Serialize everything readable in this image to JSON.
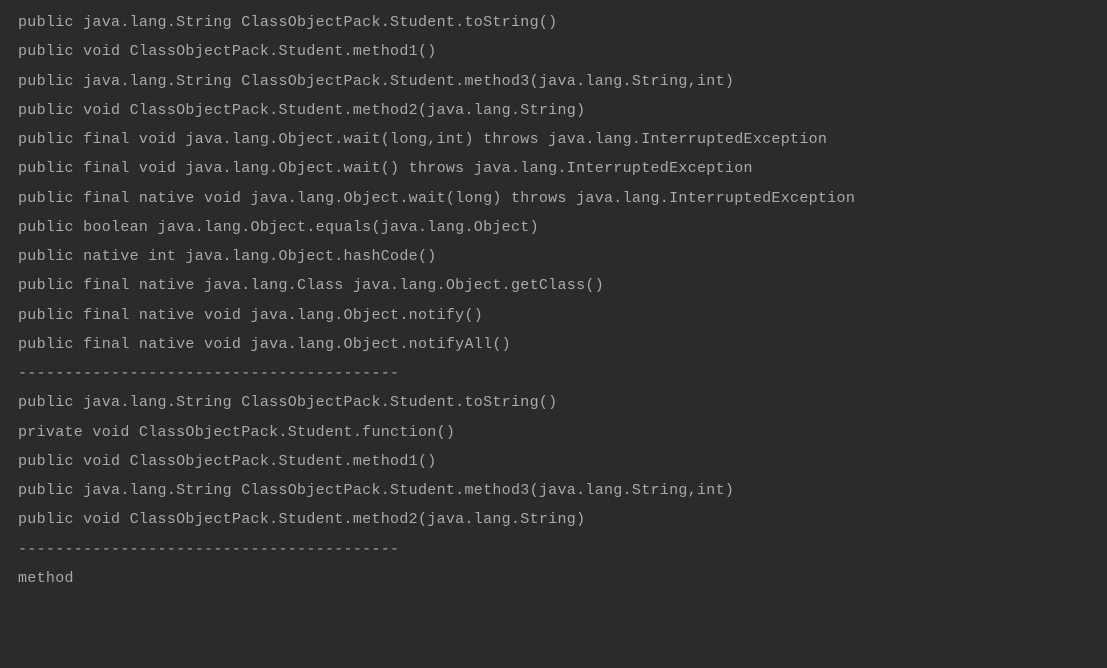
{
  "lines": [
    "public java.lang.String ClassObjectPack.Student.toString()",
    "public void ClassObjectPack.Student.method1()",
    "public java.lang.String ClassObjectPack.Student.method3(java.lang.String,int)",
    "public void ClassObjectPack.Student.method2(java.lang.String)",
    "public final void java.lang.Object.wait(long,int) throws java.lang.InterruptedException",
    "public final void java.lang.Object.wait() throws java.lang.InterruptedException",
    "public final native void java.lang.Object.wait(long) throws java.lang.InterruptedException",
    "public boolean java.lang.Object.equals(java.lang.Object)",
    "public native int java.lang.Object.hashCode()",
    "public final native java.lang.Class java.lang.Object.getClass()",
    "public final native void java.lang.Object.notify()",
    "public final native void java.lang.Object.notifyAll()",
    "-----------------------------------------",
    "public java.lang.String ClassObjectPack.Student.toString()",
    "private void ClassObjectPack.Student.function()",
    "public void ClassObjectPack.Student.method1()",
    "public java.lang.String ClassObjectPack.Student.method3(java.lang.String,int)",
    "public void ClassObjectPack.Student.method2(java.lang.String)",
    "-----------------------------------------",
    "method"
  ]
}
